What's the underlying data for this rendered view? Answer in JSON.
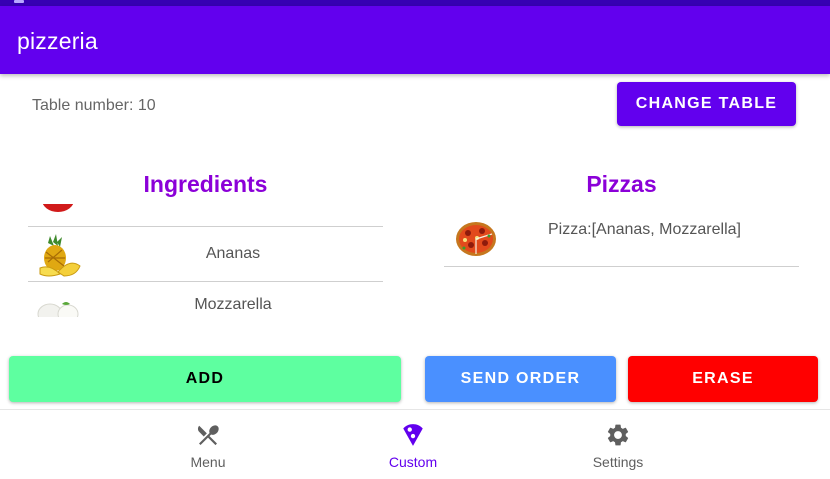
{
  "app": {
    "title": "pizzeria"
  },
  "table": {
    "label": "Table number: 10",
    "change_button": "Change table"
  },
  "ingredients": {
    "title": "Ingredients",
    "items": [
      {
        "label": "",
        "icon": "tomato-icon"
      },
      {
        "label": "Ananas",
        "icon": "pineapple-icon"
      },
      {
        "label": "Mozzarella",
        "icon": "mozzarella-icon"
      }
    ]
  },
  "pizzas": {
    "title": "Pizzas",
    "items": [
      {
        "label": "Pizza:[Ananas, Mozzarella]",
        "icon": "pizza-icon"
      }
    ]
  },
  "actions": {
    "add": "Add",
    "send_order": "Send order",
    "erase": "Erase"
  },
  "nav": {
    "items": [
      {
        "label": "Menu",
        "icon": "fork-knife-icon",
        "active": false
      },
      {
        "label": "Custom",
        "icon": "pizza-slice-icon",
        "active": true
      },
      {
        "label": "Settings",
        "icon": "gear-icon",
        "active": false
      }
    ]
  },
  "colors": {
    "primary": "#6200EE",
    "primary_dark": "#3700B3",
    "section_title": "#8B00D8",
    "add_button": "#5EFFA0",
    "send_button": "#4A90FF",
    "erase_button": "#FF0000",
    "nav_active": "#6200EE",
    "nav_inactive": "#5f5f5f"
  }
}
